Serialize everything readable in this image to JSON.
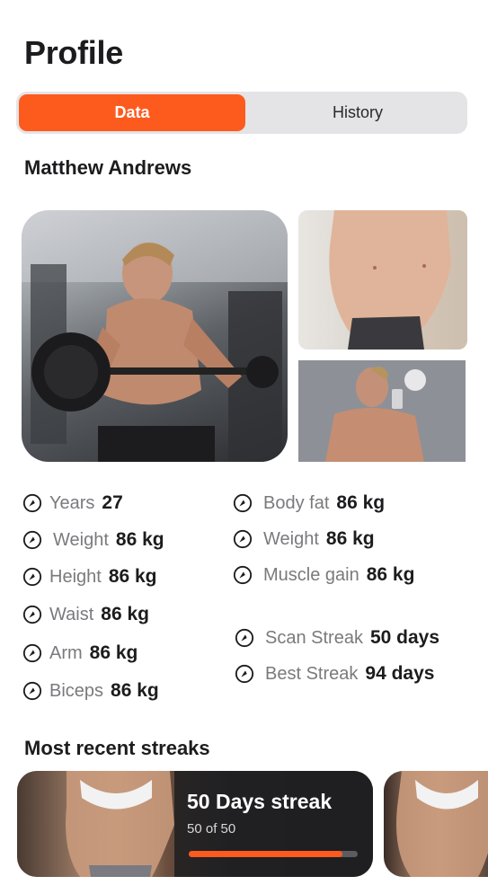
{
  "header": {
    "title": "Profile"
  },
  "tabs": [
    {
      "label": "Data",
      "active": true
    },
    {
      "label": "History",
      "active": false
    }
  ],
  "user": {
    "name": "Matthew Andrews"
  },
  "photos": [
    {
      "name": "photo-main",
      "description": "man doing barbell curl in gym"
    },
    {
      "name": "photo-torso",
      "description": "torso progress photo"
    },
    {
      "name": "photo-mirror-selfie",
      "description": "mirror selfie"
    }
  ],
  "stats_left": [
    {
      "label": "Years",
      "value": "27"
    },
    {
      "label": "Weight",
      "value": "86 kg"
    },
    {
      "label": "Height",
      "value": "86 kg"
    },
    {
      "label": "Waist",
      "value": "86 kg"
    },
    {
      "label": "Arm",
      "value": "86 kg"
    },
    {
      "label": "Biceps",
      "value": "86 kg"
    }
  ],
  "stats_right": [
    {
      "label": "Body fat",
      "value": "86 kg"
    },
    {
      "label": "Weight",
      "value": "86 kg"
    },
    {
      "label": "Muscle gain",
      "value": "86 kg"
    },
    {
      "label": "Scan Streak",
      "value": "50 days"
    },
    {
      "label": "Best Streak",
      "value": "94 days"
    }
  ],
  "streaks": {
    "title": "Most recent streaks",
    "cards": [
      {
        "title": "50 Days streak",
        "subtitle": "50 of 50",
        "progress": 0.91
      }
    ]
  },
  "colors": {
    "accent": "#fd5a1e",
    "tab_bg": "#e4e4e6",
    "label_gray": "#7a7a7e"
  },
  "icons": {
    "stat_icon": "gauge-icon"
  }
}
